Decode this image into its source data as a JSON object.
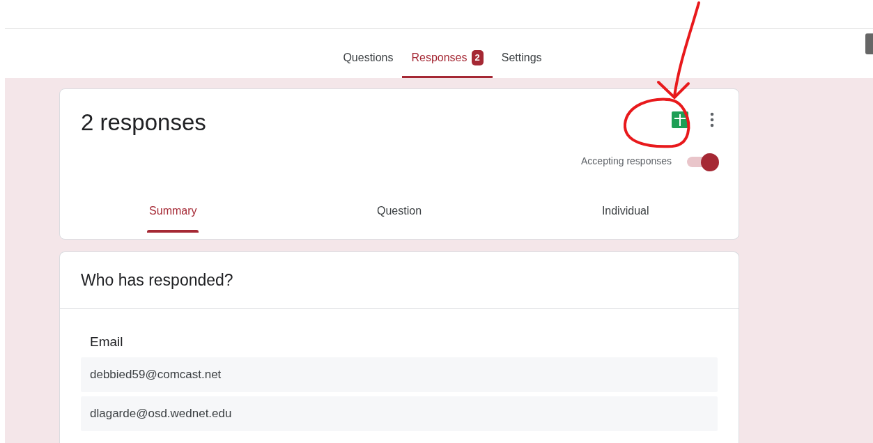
{
  "tabs": [
    {
      "label": "Questions",
      "selected": false
    },
    {
      "label": "Responses",
      "selected": true,
      "badge": "2"
    },
    {
      "label": "Settings",
      "selected": false
    }
  ],
  "summary_card": {
    "title": "2 responses",
    "accepting": {
      "label": "Accepting responses",
      "on": true
    },
    "view_tabs": [
      {
        "label": "Summary",
        "selected": true
      },
      {
        "label": "Question",
        "selected": false
      },
      {
        "label": "Individual",
        "selected": false
      }
    ]
  },
  "respondents_card": {
    "title": "Who has responded?",
    "column": "Email",
    "rows": [
      "debbied59@comcast.net",
      "dlagarde@osd.wednet.edu"
    ]
  }
}
